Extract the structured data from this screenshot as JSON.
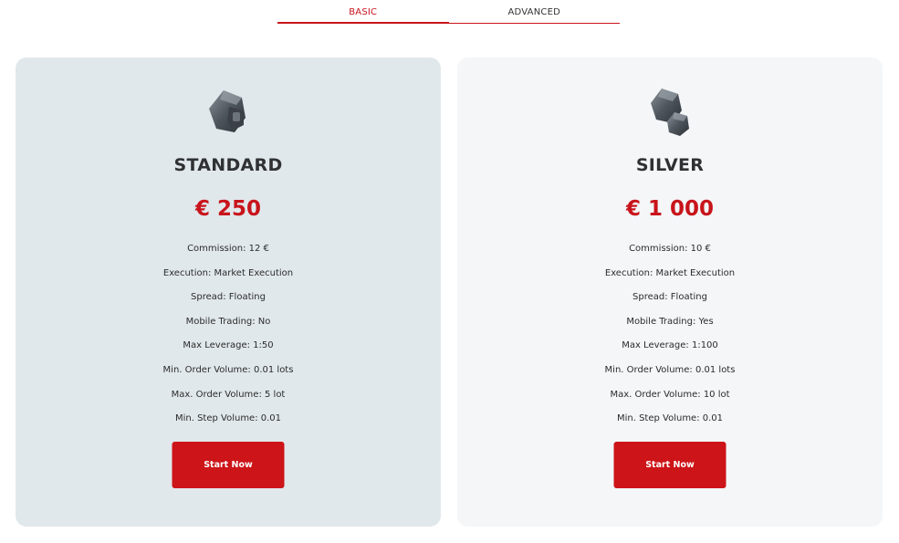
{
  "tabs": [
    {
      "label": "BASIC",
      "active": true
    },
    {
      "label": "ADVANCED",
      "active": false
    }
  ],
  "colors": {
    "accent": "#c8141b",
    "card_standard_bg": "#e1e8ec",
    "card_silver_bg": "#f4f6f8"
  },
  "plans": [
    {
      "icon": "gem-hexagon-icon",
      "name": "STANDARD",
      "price": "€ 250",
      "features": [
        "Commission: 12 €",
        "Execution: Market Execution",
        "Spread: Floating",
        "Mobile Trading: No",
        "Max Leverage: 1:50",
        "Min. Order Volume: 0.01 lots",
        "Max. Order Volume: 5 lot",
        "Min. Step Volume: 0.01"
      ],
      "button_label": "Start Now"
    },
    {
      "icon": "gem-hexagon-pair-icon",
      "name": "SILVER",
      "price": "€ 1 000",
      "features": [
        "Commission: 10 €",
        "Execution: Market Execution",
        "Spread: Floating",
        "Mobile Trading: Yes",
        "Max Leverage: 1:100",
        "Min. Order Volume: 0.01 lots",
        "Max. Order Volume: 10 lot",
        "Min. Step Volume: 0.01"
      ],
      "button_label": "Start Now"
    }
  ]
}
